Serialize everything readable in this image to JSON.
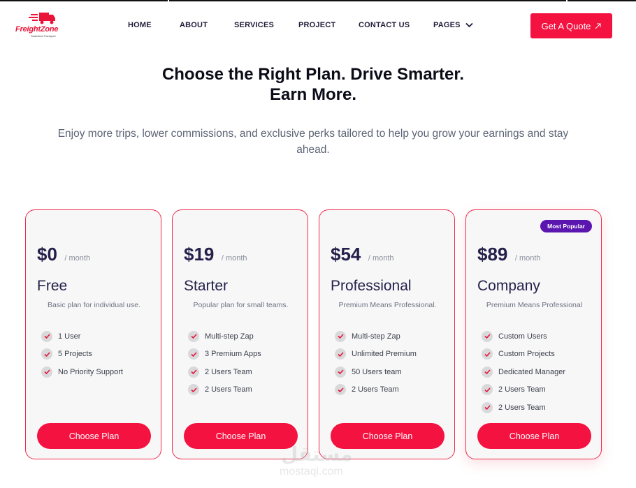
{
  "brand": {
    "name": "FreightZone",
    "tagline": "Seamless Transport",
    "accent_color": "#f41240",
    "badge_color": "#5b16b0"
  },
  "nav": {
    "items": [
      {
        "label": "HOME"
      },
      {
        "label": "ABOUT"
      },
      {
        "label": "SERVICES"
      },
      {
        "label": "PROJECT"
      },
      {
        "label": "CONTACT US"
      },
      {
        "label": "PAGES",
        "icon": "chevron-down-icon"
      }
    ],
    "cta_label": "Get A Quote",
    "cta_icon": "arrow-up-right-icon"
  },
  "hero": {
    "title_line1": "Choose the Right Plan. Drive Smarter.",
    "title_line2": "Earn More.",
    "subtitle": "Enjoy more trips, lower commissions, and exclusive perks tailored to help you grow your earnings and stay ahead."
  },
  "plans": [
    {
      "price": "$0",
      "period": "/ month",
      "name": "Free",
      "description": "Basic plan for individual use.",
      "features": [
        "1 User",
        "5 Projects",
        "No Priority Support"
      ],
      "button_label": "Choose Plan"
    },
    {
      "price": "$19",
      "period": "/ month",
      "name": "Starter",
      "description": "Popular plan for small teams.",
      "features": [
        "Multi-step Zap",
        "3 Premium Apps",
        "2 Users Team",
        "2 Users Team"
      ],
      "button_label": "Choose Plan"
    },
    {
      "price": "$54",
      "period": "/ month",
      "name": "Professional",
      "description": "Premium Means Professional.",
      "features": [
        "Multi-step Zap",
        "Unlimited Premium",
        "50 Users team",
        "2 Users Team"
      ],
      "button_label": "Choose Plan"
    },
    {
      "price": "$89",
      "period": "/ month",
      "name": "Company",
      "description": "Premium Means Professional",
      "badge": "Most Popular",
      "features": [
        "Custom Users",
        "Custom Projects",
        "Dedicated Manager",
        "2 Users Team",
        "2 Users Team"
      ],
      "button_label": "Choose Plan"
    }
  ],
  "watermark": {
    "arabic": "مستقل",
    "latin": "mostaql.com"
  }
}
